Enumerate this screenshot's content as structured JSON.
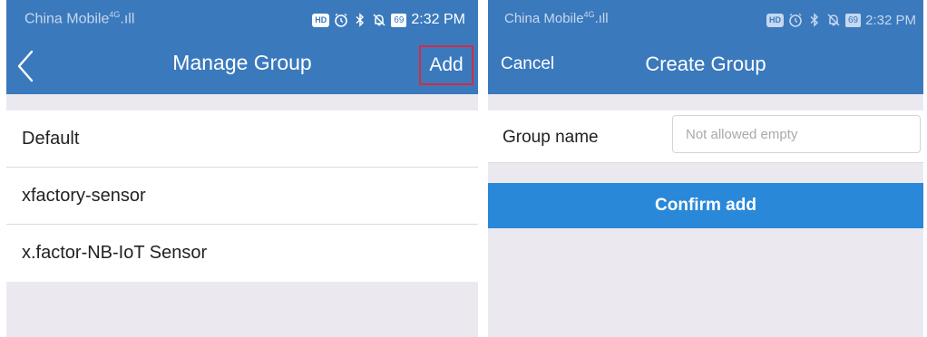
{
  "left_screen": {
    "status_bar": {
      "carrier": "China Mobile",
      "network": "4G",
      "battery": "69",
      "time": "2:32 PM"
    },
    "nav": {
      "title": "Manage Group",
      "add_label": "Add",
      "back_icon": "chevron-left-icon"
    },
    "groups": [
      {
        "name": "Default"
      },
      {
        "name": "xfactory-sensor"
      },
      {
        "name": "x.factor-NB-IoT Sensor"
      }
    ]
  },
  "right_screen": {
    "status_bar": {
      "carrier": "China Mobile",
      "network": "4G",
      "battery": "69",
      "time": "2:32 PM"
    },
    "nav": {
      "title": "Create Group",
      "cancel_label": "Cancel"
    },
    "form": {
      "group_name_label": "Group name",
      "group_name_value": "",
      "group_name_placeholder": "Not allowed empty"
    },
    "confirm_label": "Confirm add"
  },
  "colors": {
    "header": "#3b79bd",
    "accent": "#2988d8",
    "highlight_box": "#d92a3c",
    "background": "#ebe9ef"
  }
}
